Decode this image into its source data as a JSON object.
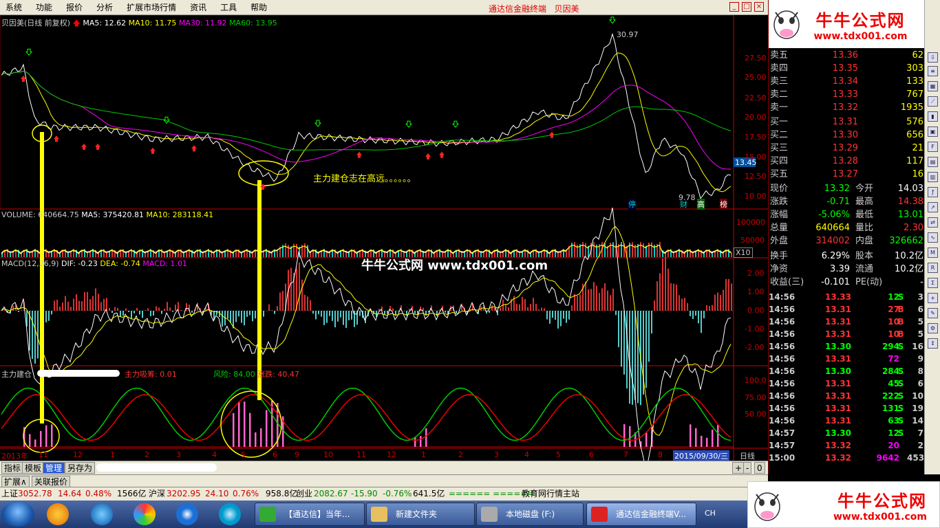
{
  "menu": {
    "items": [
      "系统",
      "功能",
      "报价",
      "分析",
      "扩展市场行情",
      "资讯",
      "工具",
      "帮助"
    ],
    "title": "通达信金融终端",
    "stock": "贝因美"
  },
  "main_chart": {
    "header": "贝因美(日线 前复权)",
    "ma5": "MA5: 12.62",
    "ma10": "MA10: 11.75",
    "ma30": "MA30: 11.92",
    "ma60": "MA60: 13.95",
    "y_ticks": [
      "27.50",
      "25.00",
      "22.50",
      "20.00",
      "17.50",
      "15.00",
      "12.50",
      "10.00"
    ],
    "high_label": "30.97",
    "low_label": "9.78",
    "current_price_tag": "13.45",
    "annotation": "主力建仓志在高远。。。。。。",
    "markers": [
      "停",
      "财",
      "高",
      "榜"
    ]
  },
  "volume_panel": {
    "label": "VOLUME: 640664.75",
    "ma5": "MA5: 375420.81",
    "ma10": "MA10: 283118.41",
    "y_ticks": [
      "100000",
      "50000"
    ],
    "unit": "X10"
  },
  "macd_panel": {
    "label": "MACD(12,26,9)",
    "dif": "DIF: -0.23",
    "dea": "DEA: -0.74",
    "macd": "MACD: 1.01",
    "y_ticks": [
      "2.00",
      "1.00",
      "0.00",
      "-1.00",
      "-2.00"
    ]
  },
  "indicator_panel": {
    "label": "主力建仓",
    "absorb": "主力吸筹: 0.01",
    "risk": "风险: 84.00",
    "change": "涨跌: 40.47",
    "y_ticks": [
      "100.0",
      "75.00",
      "50.00"
    ]
  },
  "time_axis": {
    "labels": [
      "2013年",
      "11",
      "12",
      "1",
      "2",
      "3",
      "4",
      "5",
      "6",
      "9",
      "10",
      "11",
      "12",
      "1",
      "2",
      "3",
      "4",
      "5",
      "6",
      "7",
      "8"
    ],
    "current_date": "2015/09/30/三",
    "period": "日线"
  },
  "watermark": "牛牛公式网 www.tdx001.com",
  "logo": {
    "title": "牛牛公式网",
    "url": "www.tdx001.com"
  },
  "order_book": {
    "asks": [
      {
        "label": "卖五",
        "price": "13.36",
        "vol": "62"
      },
      {
        "label": "卖四",
        "price": "13.35",
        "vol": "303"
      },
      {
        "label": "卖三",
        "price": "13.34",
        "vol": "133"
      },
      {
        "label": "卖二",
        "price": "13.33",
        "vol": "767"
      },
      {
        "label": "卖一",
        "price": "13.32",
        "vol": "1935"
      }
    ],
    "bids": [
      {
        "label": "买一",
        "price": "13.31",
        "vol": "576"
      },
      {
        "label": "买二",
        "price": "13.30",
        "vol": "656"
      },
      {
        "label": "买三",
        "price": "13.29",
        "vol": "21"
      },
      {
        "label": "买四",
        "price": "13.28",
        "vol": "117"
      },
      {
        "label": "买五",
        "price": "13.27",
        "vol": "16"
      }
    ]
  },
  "stats": [
    {
      "l1": "现价",
      "v1": "13.32",
      "l2": "今开",
      "v2": "14.03",
      "c1": "#0f0",
      "c2": "#fff"
    },
    {
      "l1": "涨跌",
      "v1": "-0.71",
      "l2": "最高",
      "v2": "14.38",
      "c1": "#0f0",
      "c2": "#f33"
    },
    {
      "l1": "涨幅",
      "v1": "-5.06%",
      "l2": "最低",
      "v2": "13.01",
      "c1": "#0f0",
      "c2": "#0f0"
    },
    {
      "l1": "总量",
      "v1": "640664",
      "l2": "量比",
      "v2": "2.30",
      "c1": "#ff0",
      "c2": "#f33"
    },
    {
      "l1": "外盘",
      "v1": "314002",
      "l2": "内盘",
      "v2": "326662",
      "c1": "#f33",
      "c2": "#0f0"
    }
  ],
  "fundamentals": [
    {
      "l1": "换手",
      "v1": "6.29%",
      "l2": "股本",
      "v2": "10.2亿"
    },
    {
      "l1": "净资",
      "v1": "3.39",
      "l2": "流通",
      "v2": "10.2亿"
    },
    {
      "l1": "收益(三)",
      "v1": "-0.101",
      "l2": "PE(动)",
      "v2": "-"
    }
  ],
  "ticks": [
    {
      "time": "14:56",
      "price": "13.33",
      "vol": "12",
      "bs": "S",
      "cnt": "3"
    },
    {
      "time": "14:56",
      "price": "13.31",
      "vol": "27",
      "bs": "B",
      "cnt": "6"
    },
    {
      "time": "14:56",
      "price": "13.31",
      "vol": "10",
      "bs": "B",
      "cnt": "5"
    },
    {
      "time": "14:56",
      "price": "13.31",
      "vol": "10",
      "bs": "B",
      "cnt": "5"
    },
    {
      "time": "14:56",
      "price": "13.30",
      "vol": "294",
      "bs": "S",
      "cnt": "16"
    },
    {
      "time": "14:56",
      "price": "13.31",
      "vol": "72",
      "bs": "",
      "cnt": "9"
    },
    {
      "time": "14:56",
      "price": "13.30",
      "vol": "284",
      "bs": "S",
      "cnt": "8"
    },
    {
      "time": "14:56",
      "price": "13.31",
      "vol": "45",
      "bs": "S",
      "cnt": "6"
    },
    {
      "time": "14:56",
      "price": "13.31",
      "vol": "222",
      "bs": "S",
      "cnt": "10"
    },
    {
      "time": "14:56",
      "price": "13.31",
      "vol": "131",
      "bs": "S",
      "cnt": "19"
    },
    {
      "time": "14:56",
      "price": "13.31",
      "vol": "63",
      "bs": "S",
      "cnt": "14"
    },
    {
      "time": "14:57",
      "price": "13.30",
      "vol": "12",
      "bs": "S",
      "cnt": "7"
    },
    {
      "time": "14:57",
      "price": "13.32",
      "vol": "20",
      "bs": "",
      "cnt": "2"
    },
    {
      "time": "15:00",
      "price": "13.32",
      "vol": "9642",
      "bs": "",
      "cnt": "453"
    }
  ],
  "bottom_tabs": [
    "指标",
    "模板",
    "管理",
    "另存为"
  ],
  "sub_tabs": [
    "扩展∧",
    "关联报价"
  ],
  "status": {
    "sh_label": "上证",
    "sh_val": "3052.78",
    "sh_chg": "14.64",
    "sh_pct": "0.48%",
    "sh_amt": "1566亿",
    "sz_label": "沪深",
    "sz_val": "3202.95",
    "sz_chg": "24.10",
    "sz_pct": "0.76%",
    "sz_amt": "958.8亿",
    "cy_label": "创业",
    "cy_val": "2082.67",
    "cy_chg": "-15.90",
    "cy_pct": "-0.76%",
    "cy_amt": "641.5亿",
    "msg": "教育网行情主站"
  },
  "taskbar": {
    "windows": [
      "【通达信】当年...",
      "新建文件夹",
      "本地磁盘 (F:)",
      "通达信金融终端V..."
    ],
    "lang": "CH"
  },
  "chart_data": {
    "type": "line",
    "title": "贝因美(日线 前复权)",
    "ylim": [
      9.78,
      30.97
    ]
  }
}
